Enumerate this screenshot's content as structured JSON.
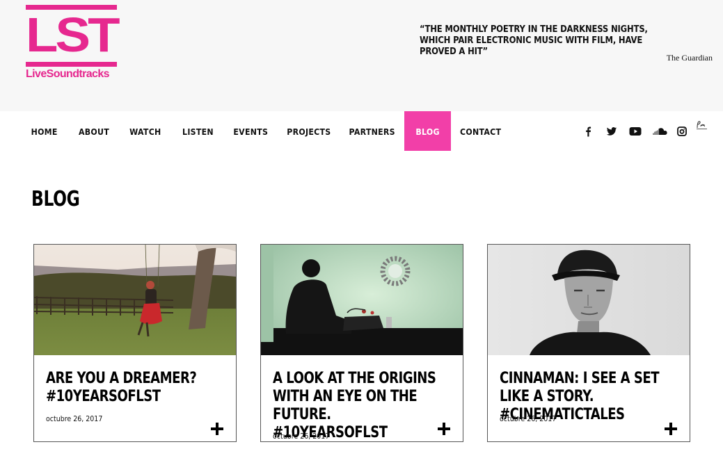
{
  "brand": {
    "logo_letters": "LST",
    "logo_wordmark": "LiveSoundtracks",
    "pink": "#e6288f",
    "nav_active": "#f23fa8"
  },
  "quote": {
    "text": "“THE MONTHLY POETRY IN THE DARKNESS NIGHTS, WHICH PAIR ELECTRONIC MUSIC WITH FILM, HAVE PROVED A HIT”",
    "source": "The Guardian"
  },
  "nav": {
    "items": [
      {
        "label": "HOME"
      },
      {
        "label": "ABOUT"
      },
      {
        "label": "WATCH"
      },
      {
        "label": "LISTEN"
      },
      {
        "label": "EVENTS"
      },
      {
        "label": "PROJECTS"
      },
      {
        "label": "PARTNERS"
      },
      {
        "label": "BLOG",
        "active": true
      },
      {
        "label": "CONTACT"
      }
    ],
    "social": [
      "facebook-icon",
      "twitter-icon",
      "youtube-icon",
      "soundcloud-icon",
      "instagram-icon",
      "poetry-in-motion-icon"
    ]
  },
  "page": {
    "title": "BLOG"
  },
  "posts": [
    {
      "title": "ARE YOU A DREAMER? #10YEARSOFLST",
      "date": "octubre 26, 2017",
      "image": "woman-on-swing-photo"
    },
    {
      "title": "A LOOK AT THE ORIGINS WITH AN EYE ON THE FUTURE. #10YEARSOFLST",
      "date": "octubre 26, 2017",
      "image": "dj-silhouette-photo"
    },
    {
      "title": "CINNAMAN: I SEE A SET LIKE A STORY. #CINEMATICTALES",
      "date": "octubre 26, 2017",
      "image": "man-in-cap-photo"
    }
  ]
}
